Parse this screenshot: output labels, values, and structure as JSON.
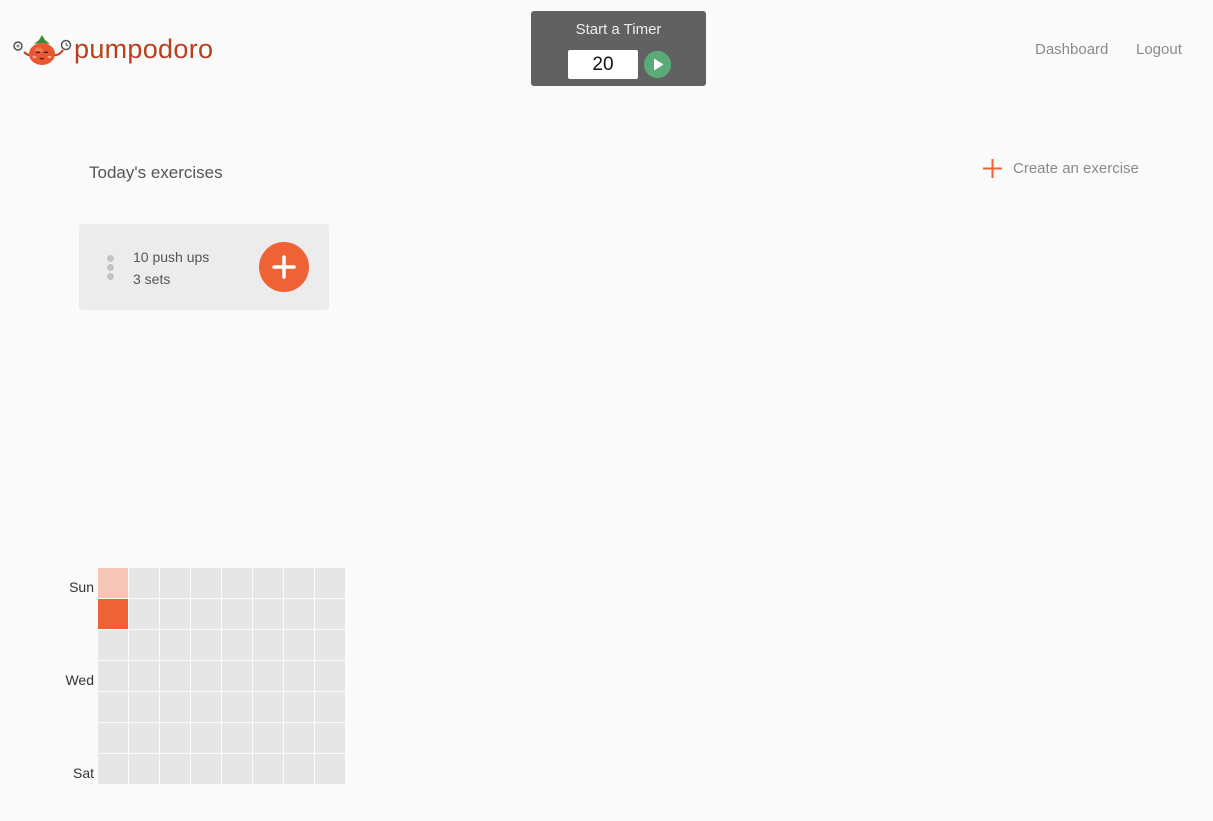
{
  "app": {
    "name": "pumpodoro"
  },
  "timer": {
    "title": "Start a Timer",
    "minutes": "20",
    "play_icon": "play-icon",
    "play_color": "#5aab78"
  },
  "nav": {
    "dashboard": "Dashboard",
    "logout": "Logout"
  },
  "main": {
    "section_title": "Today's exercises",
    "create_label": "Create an exercise",
    "create_icon": "plus-icon",
    "exercises": [
      {
        "name": "10 push ups",
        "sets": "3 sets",
        "add_icon": "plus-icon",
        "handle_icon": "drag-handle-icon"
      }
    ]
  },
  "calendar": {
    "day_labels": [
      "Sun",
      "Wed",
      "Sat"
    ],
    "weeks": 8,
    "days_per_week": 7,
    "levels": [
      [
        1,
        2,
        0,
        0,
        0,
        0,
        0
      ],
      [
        0,
        0,
        0,
        0,
        0,
        0,
        0
      ],
      [
        0,
        0,
        0,
        0,
        0,
        0,
        0
      ],
      [
        0,
        0,
        0,
        0,
        0,
        0,
        0
      ],
      [
        0,
        0,
        0,
        0,
        0,
        0,
        0
      ],
      [
        0,
        0,
        0,
        0,
        0,
        0,
        0
      ],
      [
        0,
        0,
        0,
        0,
        0,
        0,
        0
      ],
      [
        0,
        0,
        0,
        0,
        0,
        0,
        0
      ]
    ],
    "level_colors": [
      "#e6e6e6",
      "#f5c6b6",
      "#ef6236"
    ]
  },
  "colors": {
    "accent": "#ef6236",
    "brand_text": "#b8401e",
    "timer_bg": "#616161",
    "page_bg": "#fafafa"
  }
}
